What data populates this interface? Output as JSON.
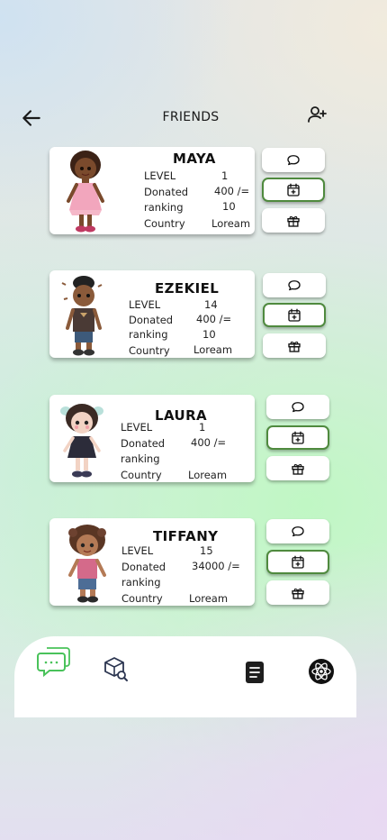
{
  "header": {
    "title": "FRIENDS",
    "back_icon": "arrow-left-icon",
    "add_icon": "add-user-icon"
  },
  "labels": {
    "level": "LEVEL",
    "donated": "Donated",
    "ranking": "ranking",
    "country": "Country"
  },
  "friends": [
    {
      "name": "MAYA",
      "level": "1",
      "donated": "400 /=",
      "ranking": "10",
      "country": "Loream"
    },
    {
      "name": "EZEKIEL",
      "level": "14",
      "donated": "400 /=",
      "ranking": "10",
      "country": "Loream"
    },
    {
      "name": "LAURA",
      "level": "1",
      "donated": "400 /=",
      "ranking": "",
      "country": "Loream"
    },
    {
      "name": "TIFFANY",
      "level": "15",
      "donated": "34000 /=",
      "ranking": "",
      "country": "Loream"
    }
  ],
  "actions": {
    "message_icon": "chat-bubble-icon",
    "schedule_icon": "calendar-add-icon",
    "gift_icon": "gift-icon"
  },
  "navbar": {
    "items": [
      "chat-icon",
      "search-box-icon",
      "document-icon",
      "atom-icon"
    ],
    "active": "chat-icon"
  },
  "colors": {
    "accent": "#4f8a3e",
    "chat_green": "#49c25a"
  }
}
